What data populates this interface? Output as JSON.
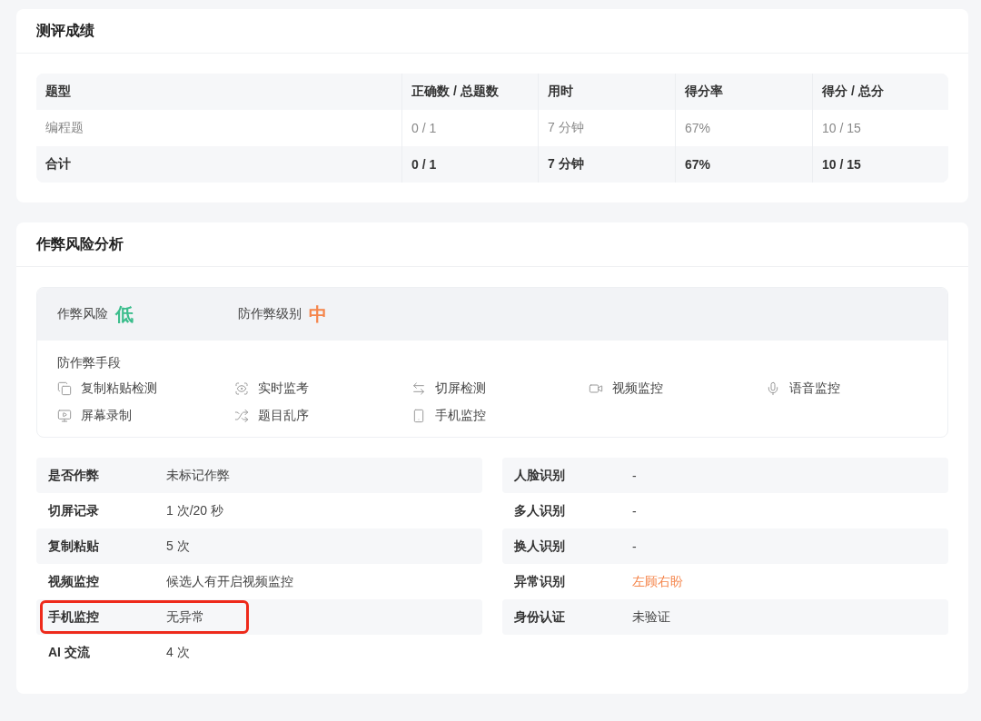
{
  "score_card": {
    "title": "测评成绩",
    "table": {
      "columns": [
        "题型",
        "正确数 / 总题数",
        "用时",
        "得分率",
        "得分 / 总分"
      ],
      "rows": [
        {
          "kind": "data",
          "cells": [
            "编程题",
            "0 / 1",
            "7 分钟",
            "67%",
            "10 / 15"
          ]
        },
        {
          "kind": "total",
          "cells": [
            "合计",
            "0 / 1",
            "7 分钟",
            "67%",
            "10 / 15"
          ]
        }
      ]
    }
  },
  "risk_card": {
    "title": "作弊风险分析",
    "summary": [
      {
        "label": "作弊风险",
        "value": "低",
        "color": "#3bbd8c"
      },
      {
        "label": "防作弊级别",
        "value": "中",
        "color": "#f5854b"
      }
    ],
    "methods_title": "防作弊手段",
    "methods": [
      "复制粘贴检测",
      "实时监考",
      "切屏检测",
      "视频监控",
      "语音监控",
      "屏幕录制",
      "题目乱序",
      "手机监控"
    ],
    "details_left": [
      {
        "label": "是否作弊",
        "value": "未标记作弊",
        "warning": false,
        "highlighted": false
      },
      {
        "label": "切屏记录",
        "value": "1 次/20 秒",
        "warning": false,
        "highlighted": false
      },
      {
        "label": "复制粘贴",
        "value": "5 次",
        "warning": false,
        "highlighted": false
      },
      {
        "label": "视频监控",
        "value": "候选人有开启视频监控",
        "warning": false,
        "highlighted": false
      },
      {
        "label": "手机监控",
        "value": "无异常",
        "warning": false,
        "highlighted": true
      },
      {
        "label": "AI 交流",
        "value": "4 次",
        "warning": false,
        "highlighted": false
      }
    ],
    "details_right": [
      {
        "label": "人脸识别",
        "value": "-",
        "warning": false,
        "highlighted": false
      },
      {
        "label": "多人识别",
        "value": "-",
        "warning": false,
        "highlighted": false
      },
      {
        "label": "换人识别",
        "value": "-",
        "warning": false,
        "highlighted": false
      },
      {
        "label": "异常识别",
        "value": "左顾右盼",
        "warning": true,
        "highlighted": false
      },
      {
        "label": "身份认证",
        "value": "未验证",
        "warning": false,
        "highlighted": false
      }
    ]
  }
}
